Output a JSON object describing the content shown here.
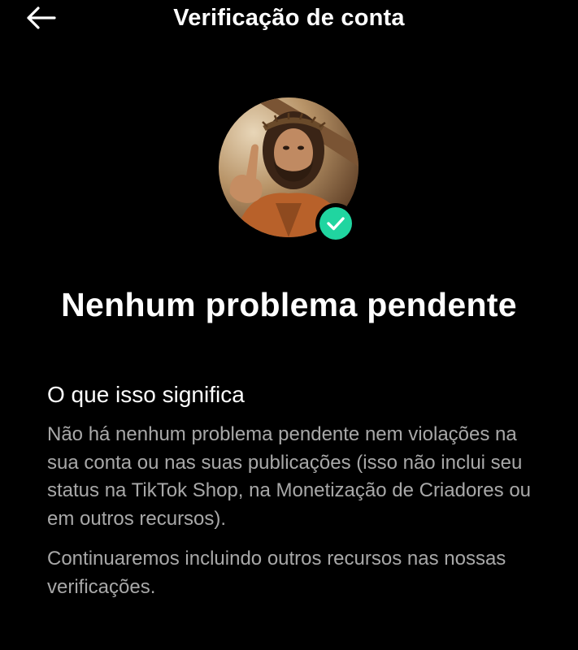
{
  "header": {
    "back_icon": "arrow-left-icon",
    "title": "Verificação de conta"
  },
  "profile": {
    "avatar_image": "profile photo",
    "badge_icon": "check-circle-icon",
    "badge_color": "#20d5a0"
  },
  "status": {
    "heading": "Nenhum problema pendente"
  },
  "info": {
    "section_title": "O que isso significa",
    "paragraph_1": "Não há nenhum problema pendente nem violações na sua conta ou nas suas publicações (isso não inclui seu status na TikTok Shop, na Monetização de Criadores ou em outros recursos).",
    "paragraph_2": "Continuaremos incluindo outros recursos nas nossas verificações."
  },
  "colors": {
    "background": "#000000",
    "text_primary": "#ffffff",
    "text_secondary": "#a8a8a8"
  }
}
